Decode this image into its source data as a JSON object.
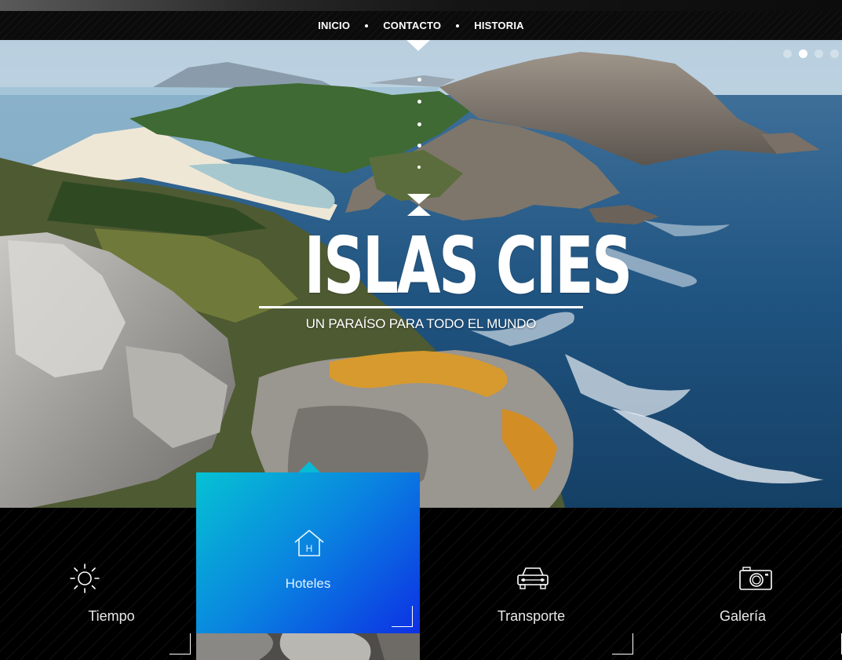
{
  "nav": {
    "items": [
      "INICIO",
      "CONTACTO",
      "HISTORIA"
    ]
  },
  "hero": {
    "title": "ISLAS CIES",
    "subtitle": "UN PARAÍSO PARA TODO EL MUNDO",
    "slider": {
      "count": 4,
      "active_index": 1
    }
  },
  "tiles": [
    {
      "label": "Tiempo",
      "icon": "sun-icon",
      "active": false
    },
    {
      "label": "Hoteles",
      "icon": "hotel-icon",
      "active": true
    },
    {
      "label": "Transporte",
      "icon": "car-icon",
      "active": false
    },
    {
      "label": "Galería",
      "icon": "camera-icon",
      "active": false
    }
  ],
  "colors": {
    "accent_start": "#06c2d3",
    "accent_end": "#0d30e4",
    "nav_bg": "#0b0b0b",
    "sea": "#1d4f7e"
  }
}
